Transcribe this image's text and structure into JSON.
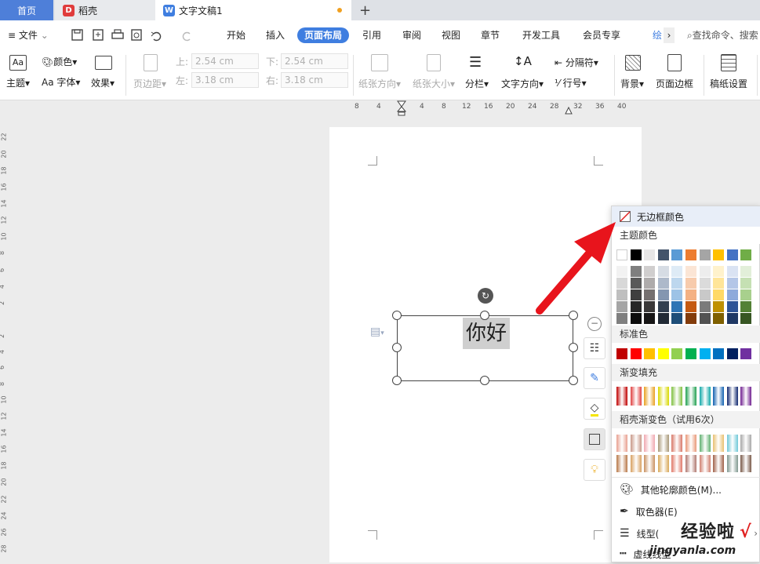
{
  "tabs": {
    "home": "首页",
    "daoke": "稻壳",
    "doc": "文字文稿1",
    "add": "+"
  },
  "menu_bar": {
    "file": "文件",
    "items": [
      "开始",
      "插入",
      "页面布局",
      "引用",
      "审阅",
      "视图",
      "章节",
      "开发工具",
      "会员专享"
    ],
    "active": "页面布局",
    "more": "绘",
    "search_placeholder": "查找命令、搜索"
  },
  "ribbon": {
    "theme": "主题",
    "color": "颜色",
    "font": "字体",
    "font_prefix": "Aa",
    "effect": "效果",
    "margin": "页边距",
    "top_label": "上:",
    "top_value": "2.54 cm",
    "left_label": "左:",
    "left_value": "3.18 cm",
    "bottom_label": "下:",
    "bottom_value": "2.54 cm",
    "right_label": "右:",
    "right_value": "3.18 cm",
    "orientation": "纸张方向",
    "size": "纸张大小",
    "columns": "分栏",
    "text_direction": "文字方向",
    "separator": "分隔符",
    "line_number": "行号",
    "background": "背景",
    "page_border": "页面边框",
    "manuscript": "稿纸设置"
  },
  "ruler_top": [
    "8",
    "4",
    "4",
    "8",
    "12",
    "16",
    "20",
    "24",
    "28",
    "32",
    "36",
    "40"
  ],
  "ruler_left": [
    "22",
    "20",
    "18",
    "16",
    "14",
    "12",
    "10",
    "8",
    "6",
    "4",
    "2",
    "2",
    "4",
    "6",
    "8",
    "10",
    "12",
    "14",
    "16",
    "18",
    "20",
    "22",
    "24",
    "26",
    "28"
  ],
  "textbox": {
    "text": "你好"
  },
  "color_menu": {
    "no_border": "无边框颜色",
    "theme_colors": "主题颜色",
    "standard_colors": "标准色",
    "gradient_fill": "渐变填充",
    "daoke_gradient": "稻壳渐变色（试用6次）",
    "other_colors": "其他轮廓颜色(M)...",
    "eyedropper": "取色器(E)",
    "line_type": "线型(",
    "dash_type": "虚线线型",
    "theme_top_row": [
      "#ffffff",
      "#000000",
      "#e7e6e6",
      "#44546a",
      "#5b9bd5",
      "#ed7d31",
      "#a5a5a5",
      "#ffc000",
      "#4472c4",
      "#70ad47"
    ],
    "theme_shades": [
      [
        "#f2f2f2",
        "#7f7f7f",
        "#d0cece",
        "#d6dce4",
        "#deebf6",
        "#fbe5d5",
        "#ededed",
        "#fff2cc",
        "#dae3f3",
        "#e2efd9"
      ],
      [
        "#d8d8d8",
        "#595959",
        "#aeabab",
        "#adb9ca",
        "#bdd7ee",
        "#f7cbac",
        "#dbdbdb",
        "#ffe599",
        "#b4c6e7",
        "#c5e0b3"
      ],
      [
        "#bfbfbf",
        "#3f3f3f",
        "#757070",
        "#8496b0",
        "#9dc3e6",
        "#f4b183",
        "#c9c9c9",
        "#ffd966",
        "#8eaadb",
        "#a8d08d"
      ],
      [
        "#a5a5a5",
        "#262626",
        "#3a3838",
        "#323f4f",
        "#2e75b5",
        "#c55a11",
        "#7b7b7b",
        "#bf9000",
        "#2f5496",
        "#538135"
      ],
      [
        "#7f7f7f",
        "#0c0c0c",
        "#171616",
        "#222a35",
        "#1e4e79",
        "#833c0b",
        "#525252",
        "#7f6000",
        "#1f3864",
        "#375623"
      ]
    ],
    "standard": [
      "#c00000",
      "#ff0000",
      "#ffc000",
      "#ffff00",
      "#92d050",
      "#00b050",
      "#00b0f0",
      "#0070c0",
      "#002060",
      "#7030a0"
    ],
    "gradients": [
      "#c00000",
      "#e04040",
      "#e8a020",
      "#d8d800",
      "#80c040",
      "#20a050",
      "#10a8a8",
      "#1060b0",
      "#102870",
      "#702090"
    ],
    "daoke_row1": [
      "#e8a090",
      "#c89888",
      "#f0a8b0",
      "#a89878",
      "#d87868",
      "#e89878",
      "#60b070",
      "#e8c070",
      "#70c8d8",
      "#a8a8a8"
    ],
    "daoke_row2": [
      "#b87848",
      "#d8a060",
      "#c89060",
      "#d8a858",
      "#e07868",
      "#b07870",
      "#d08070",
      "#a06048",
      "#809890",
      "#785848"
    ]
  },
  "watermark": {
    "brand": "经验啦",
    "check": "√",
    "url": "jingyanla.com"
  }
}
